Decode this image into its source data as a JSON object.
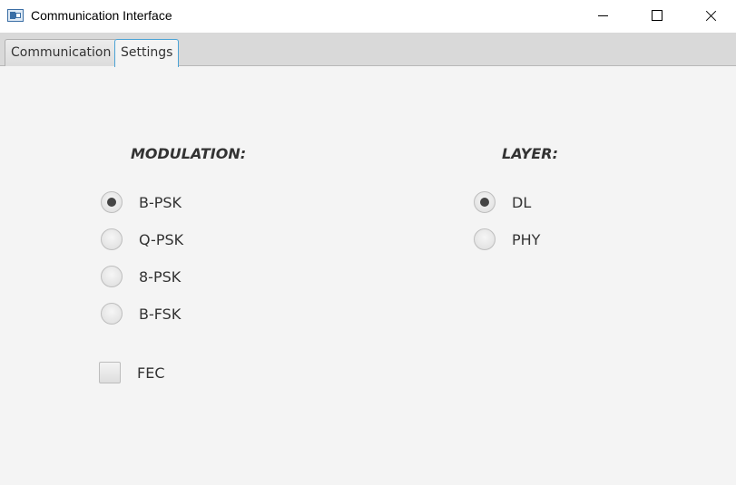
{
  "window": {
    "title": "Communication Interface"
  },
  "tabs": [
    {
      "label": "Communication",
      "selected": false
    },
    {
      "label": "Settings",
      "selected": true
    }
  ],
  "settings": {
    "modulation": {
      "label": "MODULATION:",
      "options": [
        {
          "label": "B-PSK",
          "selected": true
        },
        {
          "label": "Q-PSK",
          "selected": false
        },
        {
          "label": "8-PSK",
          "selected": false
        },
        {
          "label": "B-FSK",
          "selected": false
        }
      ]
    },
    "layer": {
      "label": "LAYER:",
      "options": [
        {
          "label": "DL",
          "selected": true
        },
        {
          "label": "PHY",
          "selected": false
        }
      ]
    },
    "fec": {
      "label": "FEC",
      "checked": false
    }
  },
  "colors": {
    "accent": "#4ba3d6",
    "background": "#f4f4f4",
    "tabbar": "#d9d9d9"
  }
}
